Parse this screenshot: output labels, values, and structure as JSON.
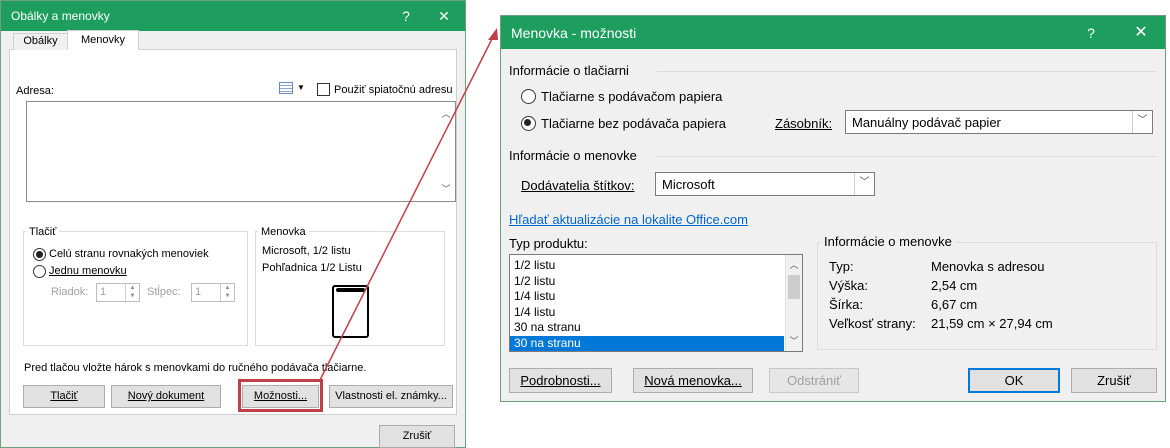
{
  "dialog1": {
    "title": "Obálky a menovky",
    "help": "?",
    "close": "✕",
    "tabs": [
      "Obálky",
      "Menovky"
    ],
    "address_label": "Adresa:",
    "return_address_label": "Použiť spiatočnú adresu",
    "print_group": {
      "title": "Tlačiť",
      "opt_full": "Celú stranu rovnakých menoviek",
      "opt_single": "Jednu menovku",
      "row_label": "Riadok:",
      "row_value": "1",
      "col_label": "Stĺpec:",
      "col_value": "1"
    },
    "label_group": {
      "title": "Menovka",
      "line1": "Microsoft, 1/2 listu",
      "line2": "Pohľadnica 1/2  Listu"
    },
    "instruction": "Pred tlačou vložte hárok s menovkami do ručného podávača tlačiarne.",
    "buttons": {
      "print": "Tlačiť",
      "new_doc": "Nový dokument",
      "options": "Možnosti...",
      "eprops": "Vlastnosti el. známky...",
      "cancel": "Zrušiť"
    }
  },
  "dialog2": {
    "title": "Menovka - možnosti",
    "help": "?",
    "close": "✕",
    "printer_info": {
      "title": "Informácie o tlačiarni",
      "opt_feed": "Tlačiarne s podávačom papiera",
      "opt_nofeed": "Tlačiarne bez podávača papiera",
      "tray_label": "Zásobník:",
      "tray_value": "Manuálny podávač papier"
    },
    "label_info": {
      "title": "Informácie o menovke",
      "vendor_label": "Dodávatelia štítkov:",
      "vendor_value": "Microsoft"
    },
    "update_link": "Hľadať aktualizácie na lokalite Office.com",
    "product_type_label": "Typ produktu:",
    "products": [
      "1/2 listu",
      "1/2 listu",
      "1/4 listu",
      "1/4 listu",
      "30 na stranu",
      "30 na stranu"
    ],
    "selected_product_index": 5,
    "details": {
      "title": "Informácie o menovke",
      "rows": [
        {
          "k": "Typ:",
          "v": "Menovka s adresou"
        },
        {
          "k": "Výška:",
          "v": "2,54 cm"
        },
        {
          "k": "Šírka:",
          "v": "6,67 cm"
        },
        {
          "k": "Veľkosť strany:",
          "v": "21,59 cm × 27,94 cm"
        }
      ]
    },
    "buttons": {
      "details": "Podrobnosti...",
      "new_label": "Nová menovka...",
      "delete": "Odstrániť",
      "ok": "OK",
      "cancel": "Zrušiť"
    }
  },
  "colors": {
    "titlebar": "#1e9e5e",
    "highlight": "#c0404a",
    "accent": "#0078d7",
    "link": "#0066cc"
  },
  "icons": {
    "address_book": "address-book-icon",
    "dropdown": "chevron-down-icon",
    "label_preview": "label-sheet-icon"
  }
}
